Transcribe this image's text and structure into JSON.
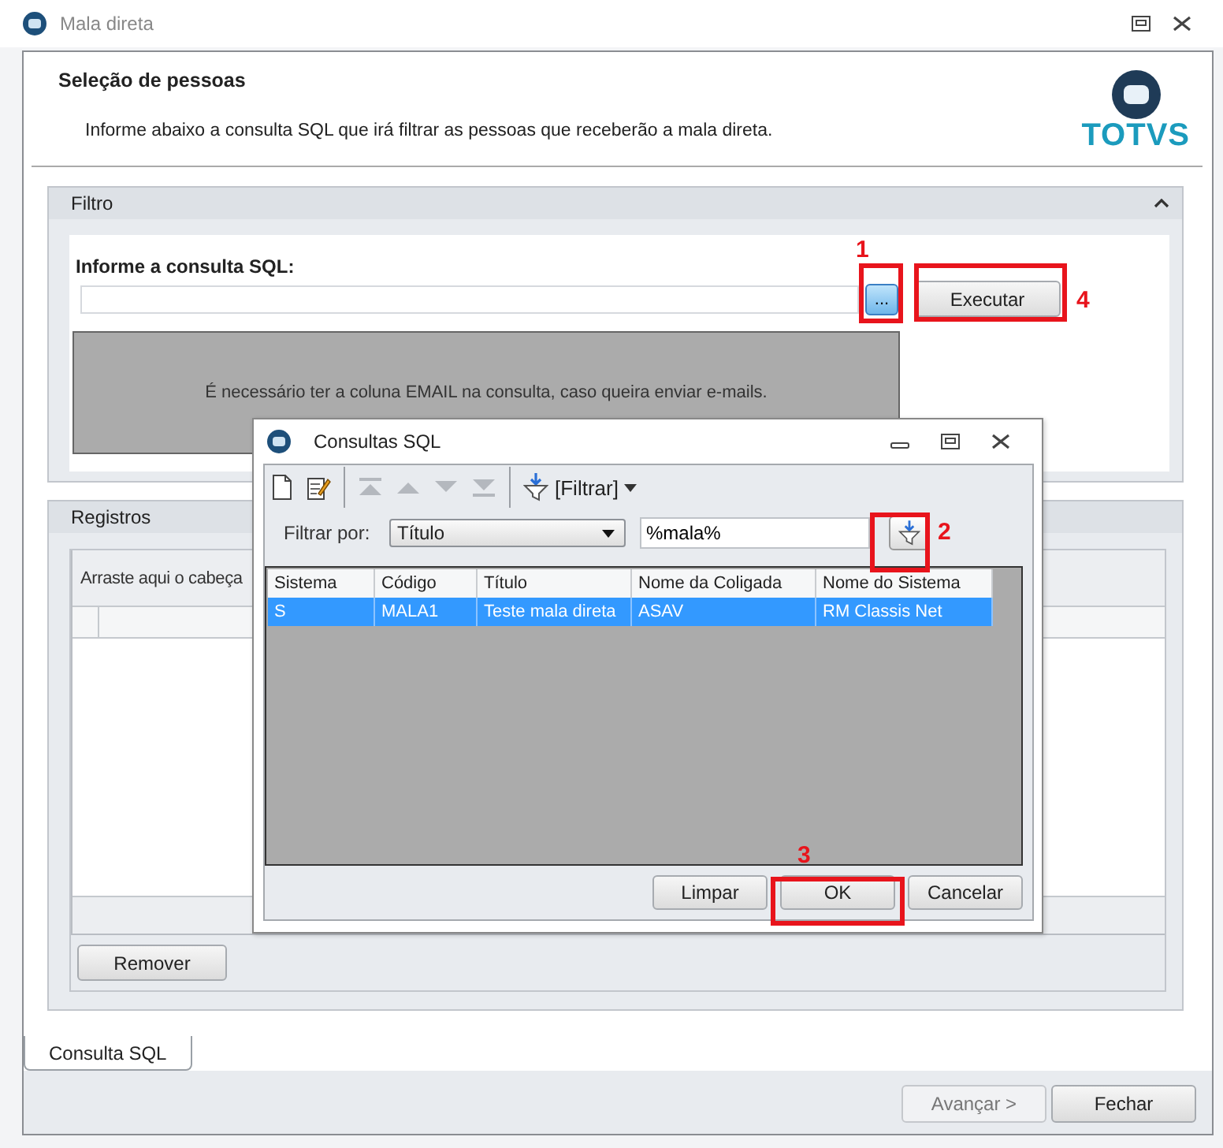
{
  "window": {
    "title": "Mala direta"
  },
  "header": {
    "title": "Seleção de pessoas",
    "description": "Informe abaixo a consulta SQL que irá filtrar as pessoas que receberão a mala direta.",
    "logo": "TOTVS"
  },
  "filter_panel": {
    "title": "Filtro",
    "expanded": true,
    "sql_label": "Informe a consulta SQL:",
    "browse_button": "...",
    "execute_button": "Executar",
    "notice": "É necessário ter a coluna EMAIL na consulta, caso queira enviar e-mails."
  },
  "records_panel": {
    "title": "Registros",
    "group_hint": "Arraste aqui o cabeça",
    "remove_button": "Remover"
  },
  "tabs": [
    {
      "label": "Consulta SQL",
      "selected": true
    }
  ],
  "buttons": [
    {
      "label": "Avançar >",
      "disabled": true
    },
    {
      "label": "Fechar",
      "disabled": false
    }
  ],
  "dialog": {
    "title": "Consultas SQL",
    "toolbar": [
      {
        "kind": "new",
        "disabled": false
      },
      {
        "kind": "edit",
        "disabled": false
      },
      {
        "kind": "separator"
      },
      {
        "kind": "first",
        "disabled": true
      },
      {
        "kind": "up",
        "disabled": true
      },
      {
        "kind": "down",
        "disabled": true
      },
      {
        "kind": "last",
        "disabled": true
      },
      {
        "kind": "separator"
      },
      {
        "kind": "filter",
        "label": "[Filtrar]",
        "disabled": false
      }
    ],
    "filter_by_label": "Filtrar por:",
    "filter_field": "Título",
    "filter_value": "%mala%",
    "table": {
      "columns": [
        "Sistema",
        "Código",
        "Título",
        "Nome da Coligada",
        "Nome do Sistema"
      ],
      "rows": [
        {
          "cells": [
            "S",
            "MALA1",
            "Teste mala direta",
            "ASAV",
            "RM Classis Net"
          ],
          "selected": true
        }
      ]
    },
    "buttons": [
      {
        "label": "Limpar"
      },
      {
        "label": "OK"
      },
      {
        "label": "Cancelar"
      }
    ]
  },
  "annotations": [
    {
      "number": "1"
    },
    {
      "number": "4"
    },
    {
      "number": "2"
    },
    {
      "number": "3"
    }
  ]
}
